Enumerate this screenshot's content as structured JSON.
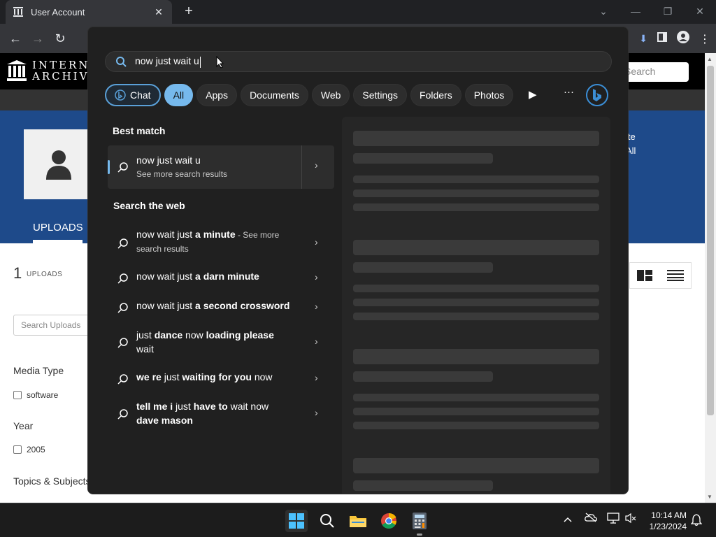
{
  "browser": {
    "tab_title": "User Account",
    "new_tab": "+",
    "close_tab": "✕"
  },
  "archive": {
    "wordmark_line1": "INTERNET",
    "wordmark_line2": "ARCHIVE",
    "search_placeholder": "Search",
    "banner_text_line1": "ite",
    "banner_text_line2": "All",
    "uploads_tab": "UPLOADS",
    "upload_count": "1",
    "upload_label": "UPLOADS",
    "search_uploads_placeholder": "Search Uploads",
    "facets": [
      {
        "title": "Media Type",
        "item": "software"
      },
      {
        "title": "Year",
        "item": "2005"
      },
      {
        "title": "Topics & Subjects",
        "item": ""
      }
    ]
  },
  "flyout": {
    "query": "now just wait u",
    "filters": [
      "Chat",
      "All",
      "Apps",
      "Documents",
      "Web",
      "Settings",
      "Folders",
      "Photos"
    ],
    "active_filter": "All",
    "best_match_title": "Best match",
    "best_match": {
      "title": "now just wait u",
      "subtitle": "See more search results"
    },
    "web_title": "Search the web",
    "web_results": [
      {
        "normal": "now wait just ",
        "bold": "a minute",
        "tail": " - See more",
        "line2": "search results"
      },
      {
        "normal": "now wait just ",
        "bold": "a darn minute",
        "tail": "",
        "line2": ""
      },
      {
        "normal": "now wait just ",
        "bold": "a second crossword",
        "tail": "",
        "line2": ""
      },
      {
        "normal": "just ",
        "bold": "dance",
        "tail": " now ",
        "bold2": "loading please",
        "line2": "wait"
      },
      {
        "normal": "",
        "bold": "we re",
        "tail": " just ",
        "bold2": "waiting for you",
        "tail2": " now",
        "line2": ""
      },
      {
        "normal": "",
        "bold": "tell me i",
        "tail": " just ",
        "bold2": "have to",
        "tail2": " wait now",
        "line2_bold": "dave mason"
      }
    ]
  },
  "taskbar": {
    "time": "10:14 AM",
    "date": "1/23/2024"
  },
  "colors": {
    "accent": "#76b9ed",
    "archive_banner": "#1e4a8a",
    "flyout_bg": "#202020"
  }
}
